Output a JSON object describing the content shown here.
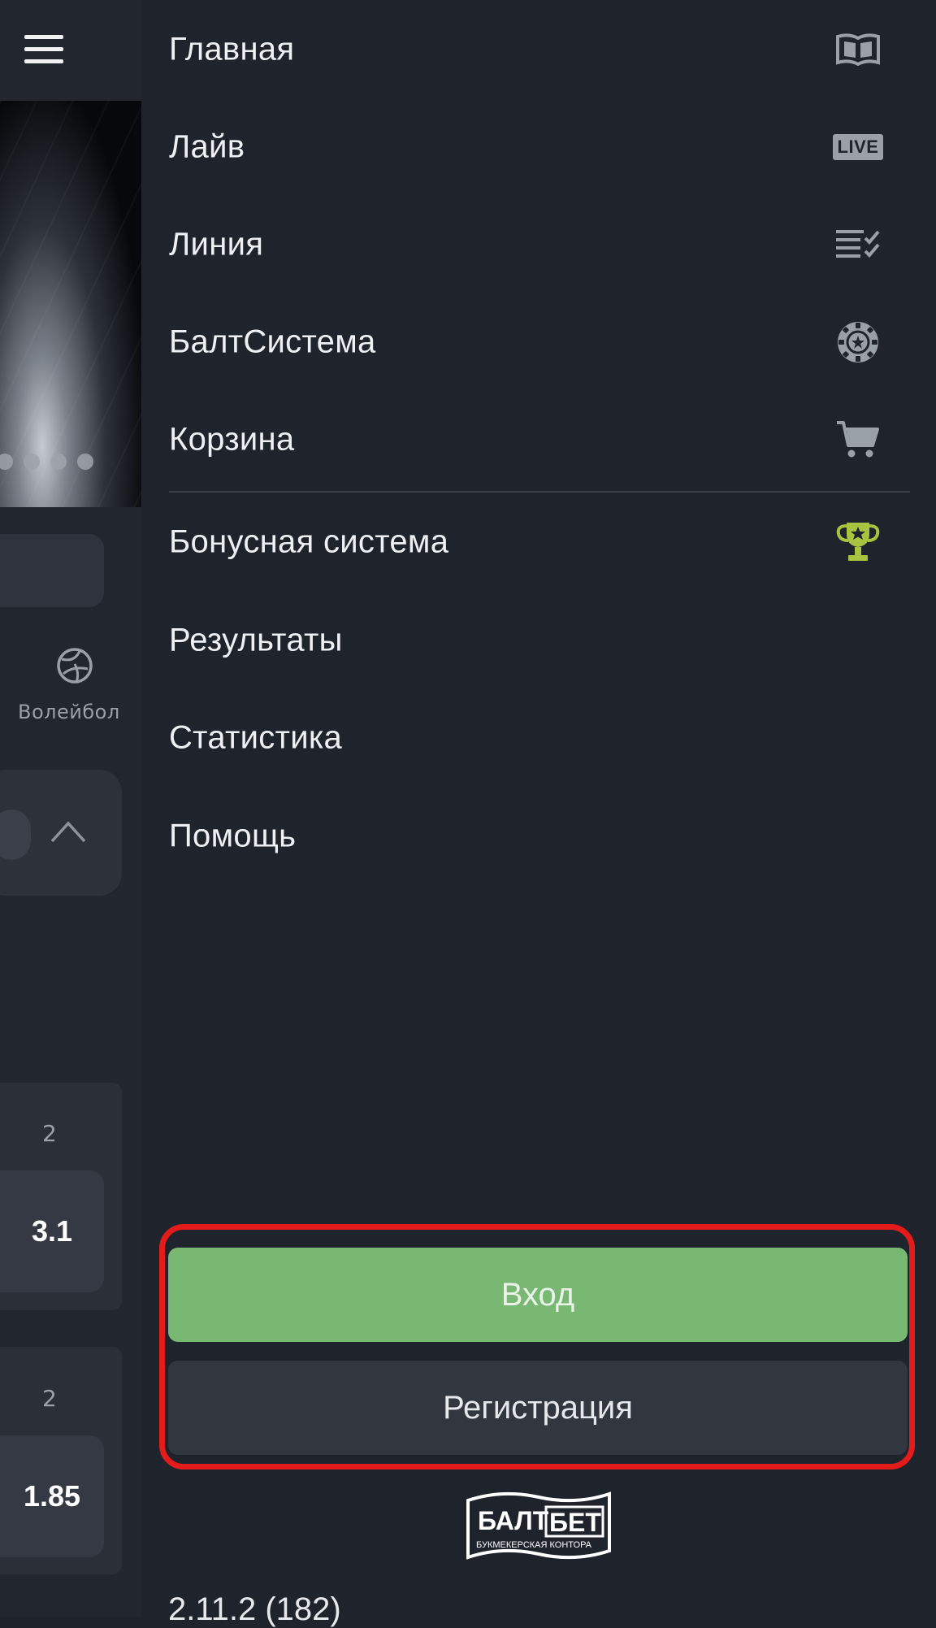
{
  "background_app": {
    "sport_label": "Волейбол",
    "odds": [
      {
        "head": "2",
        "value": "3.1"
      },
      {
        "head": "2",
        "value": "1.85"
      }
    ]
  },
  "menu": {
    "items": [
      {
        "label": "Главная",
        "icon": "home-book-icon"
      },
      {
        "label": "Лайв",
        "icon": "live-icon",
        "badge": "LIVE"
      },
      {
        "label": "Линия",
        "icon": "checklist-icon"
      },
      {
        "label": "БалтСистема",
        "icon": "chip-icon"
      },
      {
        "label": "Корзина",
        "icon": "cart-icon"
      },
      {
        "label": "Бонусная система",
        "icon": "trophy-icon"
      },
      {
        "label": "Результаты"
      },
      {
        "label": "Статистика"
      },
      {
        "label": "Помощь"
      }
    ]
  },
  "auth": {
    "login_label": "Вход",
    "register_label": "Регистрация"
  },
  "logo": {
    "word1": "БАЛТ",
    "word2": "БЕТ",
    "tagline": "БУКМЕКЕРСКАЯ КОНТОРА"
  },
  "version": "2.11.2 (182)",
  "colors": {
    "background": "#1f232c",
    "login_button": "#79b873",
    "register_button": "#31363f",
    "highlight": "#e41b1b",
    "trophy": "#a9c23f"
  }
}
